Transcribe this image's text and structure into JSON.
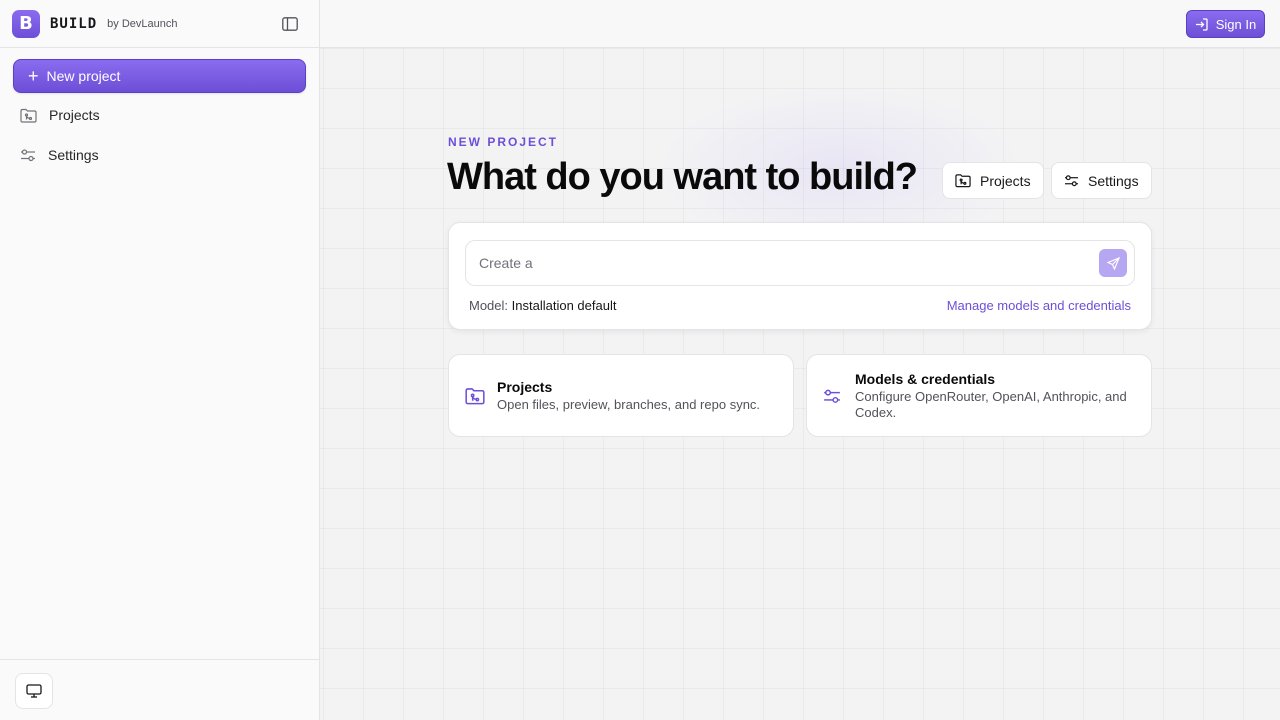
{
  "sidebar": {
    "brand": "BUILD",
    "brand_by": "by DevLaunch",
    "logo_letter": "B",
    "new_project_label": "New project",
    "items": [
      {
        "label": "Projects",
        "icon": "folder-git-icon"
      },
      {
        "label": "Settings",
        "icon": "sliders-icon"
      }
    ],
    "footer_icon": "monitor-icon"
  },
  "topbar": {
    "sign_in_label": "Sign In",
    "sign_in_icon": "log-in-icon"
  },
  "hero": {
    "eyebrow": "NEW PROJECT",
    "headline": "What do you want to build?",
    "projects_button": "Projects",
    "settings_button": "Settings"
  },
  "prompt": {
    "placeholder": "Create a",
    "value": "",
    "model_label": "Model:",
    "model_value": "Installation default",
    "manage_link": "Manage models and credentials"
  },
  "cards": [
    {
      "title": "Projects",
      "description": "Open files, preview, branches, and repo sync.",
      "icon": "folder-git-icon"
    },
    {
      "title": "Models & credentials",
      "description": "Configure OpenRouter, OpenAI, Anthropic, and Codex.",
      "icon": "sliders-icon"
    }
  ],
  "colors": {
    "accent": "#6d4fd8",
    "accent_light": "#8a6cf0"
  }
}
